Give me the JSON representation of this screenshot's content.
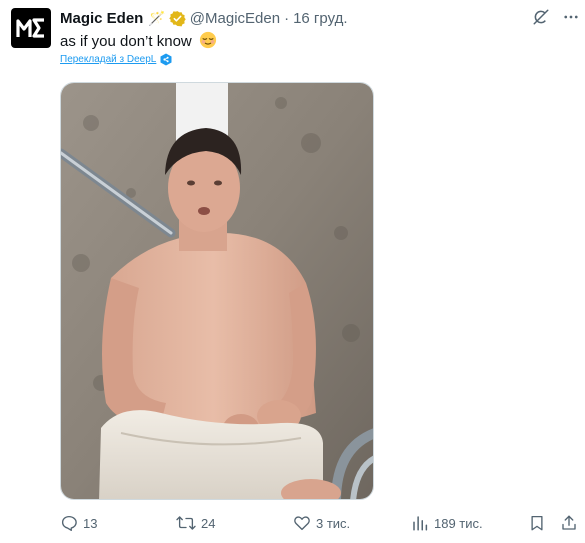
{
  "author": {
    "display_name": "Magic Eden",
    "name_emoji": "🪄",
    "handle": "@MagicEden",
    "separator": "·",
    "date": "16 груд.",
    "avatar_logo": "ME"
  },
  "tweet": {
    "text": "as if you don’t know",
    "emoji": "relieved-face",
    "translate_label": "Перекладай з DeepL"
  },
  "actions": {
    "replies": "13",
    "retweets": "24",
    "likes": "3 тис.",
    "views": "189 тис."
  },
  "icons": {
    "verified": "verified-badge-gold",
    "grok": "grok-icon",
    "bookmark": "bookmark-icon",
    "share": "share-icon"
  },
  "colors": {
    "text": "#0f1419",
    "secondary": "#536471",
    "link": "#1d9bf0",
    "verified_gold": "#e2b719"
  }
}
